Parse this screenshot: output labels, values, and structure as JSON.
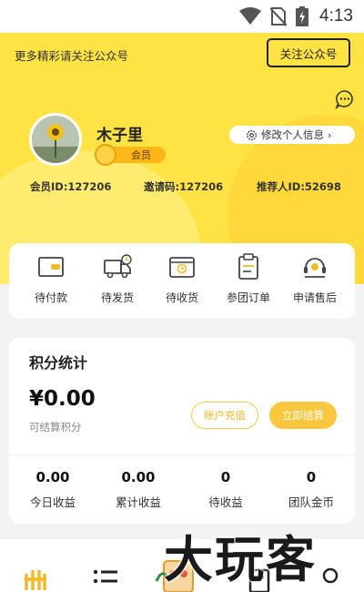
{
  "status_bar": {
    "time": "4:13"
  },
  "header": {
    "follow_prompt": "更多精彩请关注公众号",
    "follow_button": "关注公众号"
  },
  "profile": {
    "name": "木子里",
    "level_badge": "会员",
    "edit_button": "修改个人信息",
    "member_id": "会员ID:127206",
    "invite_code": "邀请码:127206",
    "referrer_id": "推荐人ID:52698"
  },
  "orders": {
    "items": [
      {
        "label": "待付款",
        "icon": "wallet-icon"
      },
      {
        "label": "待发货",
        "icon": "truck-icon"
      },
      {
        "label": "待收货",
        "icon": "package-icon"
      },
      {
        "label": "参团订单",
        "icon": "clipboard-icon"
      },
      {
        "label": "申请售后",
        "icon": "support-icon"
      }
    ]
  },
  "points": {
    "title": "积分统计",
    "amount": "¥0.00",
    "amount_label": "可结算积分",
    "recharge_button": "账户充值",
    "settle_button": "立即结算",
    "stats": [
      {
        "value": "0.00",
        "label": "今日收益"
      },
      {
        "value": "0.00",
        "label": "累计收益"
      },
      {
        "value": "0",
        "label": "待收益"
      },
      {
        "value": "0",
        "label": "团队金币"
      }
    ]
  },
  "watermark": "大玩客",
  "colors": {
    "accent": "#ffe244",
    "button": "#f9c83f"
  }
}
